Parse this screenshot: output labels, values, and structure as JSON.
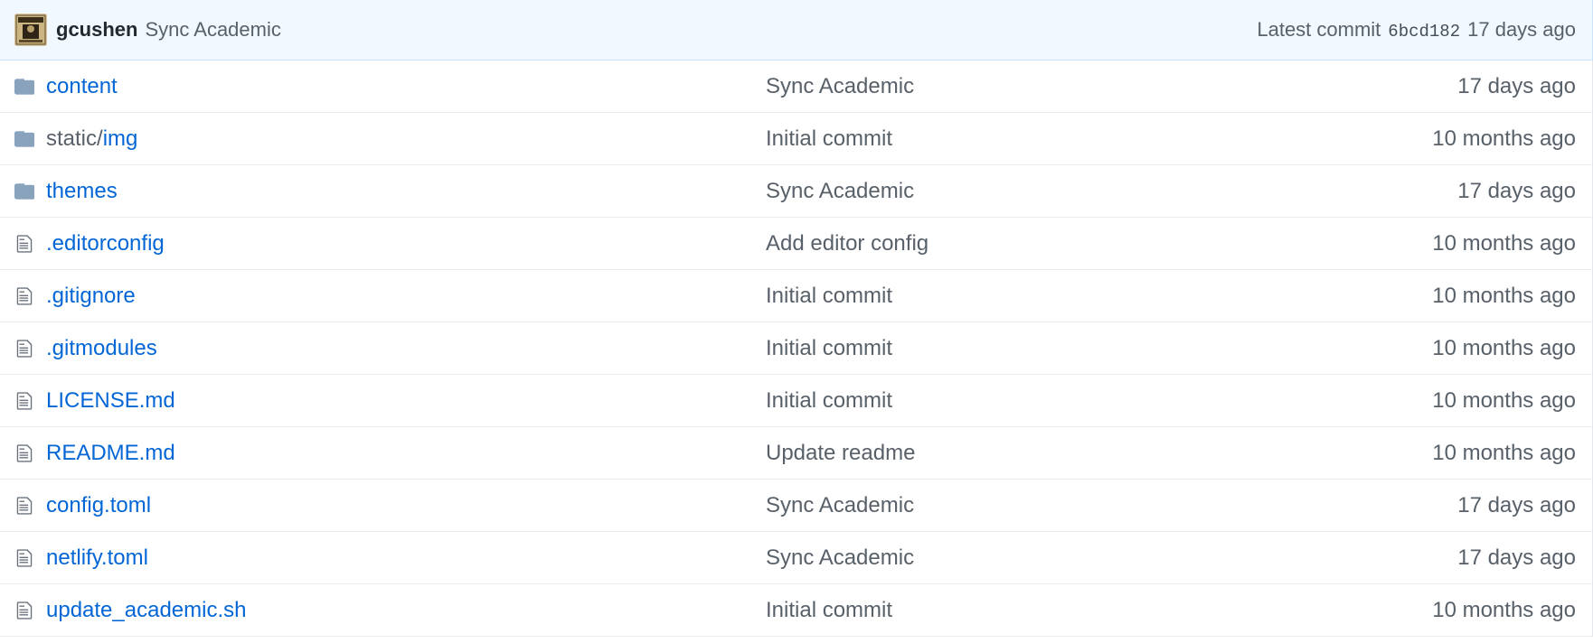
{
  "latest_commit": {
    "author": "gcushen",
    "message": "Sync Academic",
    "label": "Latest commit",
    "sha": "6bcd182",
    "age": "17 days ago",
    "avatar_icon": "wanted-poster-avatar"
  },
  "files": [
    {
      "type": "directory",
      "prefix": "",
      "name": "content",
      "message": "Sync Academic",
      "age": "17 days ago"
    },
    {
      "type": "directory",
      "prefix": "static/",
      "name": "img",
      "message": "Initial commit",
      "age": "10 months ago"
    },
    {
      "type": "directory",
      "prefix": "",
      "name": "themes",
      "message": "Sync Academic",
      "age": "17 days ago"
    },
    {
      "type": "file",
      "prefix": "",
      "name": ".editorconfig",
      "message": "Add editor config",
      "age": "10 months ago"
    },
    {
      "type": "file",
      "prefix": "",
      "name": ".gitignore",
      "message": "Initial commit",
      "age": "10 months ago"
    },
    {
      "type": "file",
      "prefix": "",
      "name": ".gitmodules",
      "message": "Initial commit",
      "age": "10 months ago"
    },
    {
      "type": "file",
      "prefix": "",
      "name": "LICENSE.md",
      "message": "Initial commit",
      "age": "10 months ago"
    },
    {
      "type": "file",
      "prefix": "",
      "name": "README.md",
      "message": "Update readme",
      "age": "10 months ago"
    },
    {
      "type": "file",
      "prefix": "",
      "name": "config.toml",
      "message": "Sync Academic",
      "age": "17 days ago"
    },
    {
      "type": "file",
      "prefix": "",
      "name": "netlify.toml",
      "message": "Sync Academic",
      "age": "17 days ago"
    },
    {
      "type": "file",
      "prefix": "",
      "name": "update_academic.sh",
      "message": "Initial commit",
      "age": "10 months ago"
    }
  ],
  "colors": {
    "link": "#0366d6",
    "muted": "#586069",
    "folder_icon": "#79b8ff",
    "header_bg": "#f1f8ff"
  }
}
